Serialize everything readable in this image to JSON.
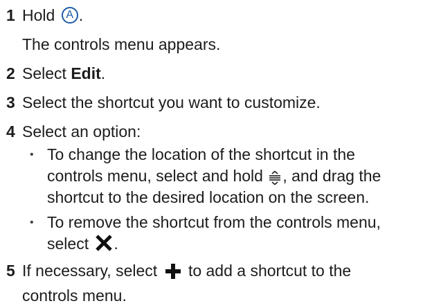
{
  "steps": [
    {
      "number": "1",
      "pre": "Hold",
      "icon_button_letter": "A",
      "post": ".",
      "result": "The controls menu appears."
    },
    {
      "number": "2",
      "pre": "Select",
      "bold": "Edit",
      "post": "."
    },
    {
      "number": "3",
      "text": "Select the shortcut you want to customize."
    },
    {
      "number": "4",
      "text": "Select an option:",
      "options": [
        {
          "line1": "To change the location of the shortcut in the",
          "line2_pre": "controls menu, select and hold",
          "line2_post": ", and drag the",
          "line3": "shortcut to the desired location on the screen.",
          "icon": "reorder-icon"
        },
        {
          "line1": "To remove the shortcut from the controls menu,",
          "line2_pre": "select",
          "line2_post": ".",
          "icon": "close-x-icon"
        }
      ]
    },
    {
      "number": "5",
      "pre": "If necessary, select",
      "post": "to add a shortcut to the",
      "line2": "controls menu.",
      "icon": "plus-icon"
    }
  ],
  "colors": {
    "text": "#1c1c1c",
    "accent": "#1d5ba8"
  }
}
